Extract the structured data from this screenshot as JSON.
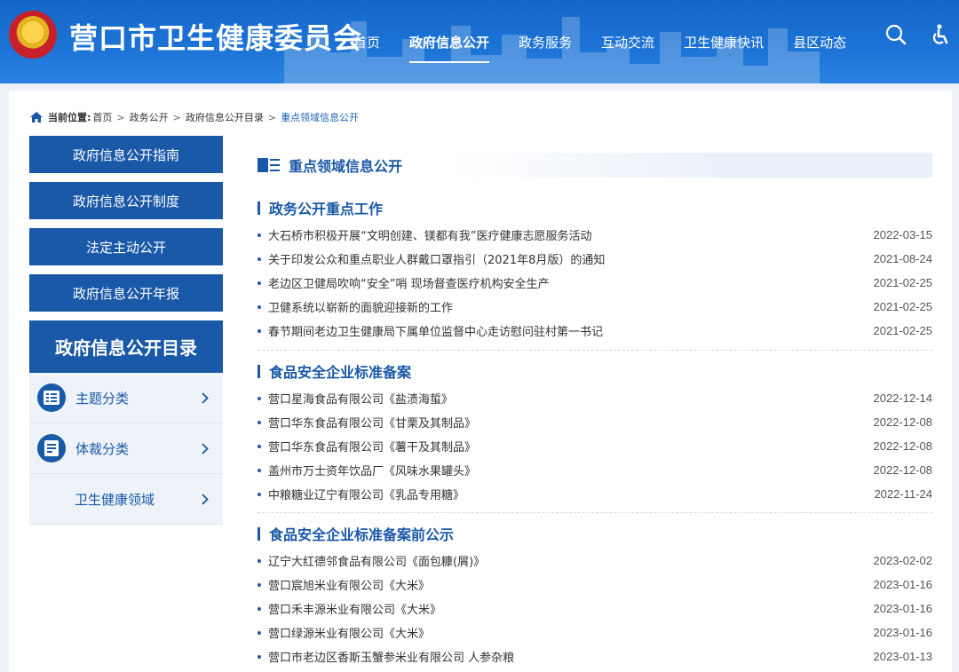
{
  "header": {
    "site_title": "营口市卫生健康委员会",
    "nav": [
      {
        "label": "首页",
        "active": false
      },
      {
        "label": "政府信息公开",
        "active": true
      },
      {
        "label": "政务服务",
        "active": false
      },
      {
        "label": "互动交流",
        "active": false
      },
      {
        "label": "卫生健康快讯",
        "active": false
      },
      {
        "label": "县区动态",
        "active": false
      }
    ],
    "icons": [
      "search-icon",
      "accessibility-icon"
    ]
  },
  "breadcrumb": {
    "prefix": "当前位置:",
    "items": [
      "首页",
      "政务公开",
      "政府信息公开目录"
    ],
    "current": "重点领域信息公开",
    "separator": ">"
  },
  "sidebar": {
    "buttons": [
      "政府信息公开指南",
      "政府信息公开制度",
      "法定主动公开",
      "政府信息公开年报"
    ],
    "catalog_title": "政府信息公开目录",
    "catalog_items": [
      {
        "label": "主题分类",
        "icon": "list-icon"
      },
      {
        "label": "体裁分类",
        "icon": "document-icon"
      },
      {
        "label": "卫生健康领域",
        "icon": ""
      }
    ]
  },
  "content": {
    "title": "重点领域信息公开",
    "sections": [
      {
        "title": "政务公开重点工作",
        "items": [
          {
            "text": "大石桥市积极开展“文明创建、镁都有我”医疗健康志愿服务活动",
            "date": "2022-03-15"
          },
          {
            "text": "关于印发公众和重点职业人群戴口罩指引（2021年8月版）的通知",
            "date": "2021-08-24"
          },
          {
            "text": "老边区卫健局吹响“安全”哨 现场督查医疗机构安全生产",
            "date": "2021-02-25"
          },
          {
            "text": "卫健系统以崭新的面貌迎接新的工作",
            "date": "2021-02-25"
          },
          {
            "text": "春节期间老边卫生健康局下属单位监督中心走访慰问驻村第一书记",
            "date": "2021-02-25"
          }
        ]
      },
      {
        "title": "食品安全企业标准备案",
        "items": [
          {
            "text": "营口星海食品有限公司《盐渍海蜇》",
            "date": "2022-12-14"
          },
          {
            "text": "营口华东食品有限公司《甘栗及其制品》",
            "date": "2022-12-08"
          },
          {
            "text": "营口华东食品有限公司《薯干及其制品》",
            "date": "2022-12-08"
          },
          {
            "text": "盖州市万士资年饮品厂《风味水果罐头》",
            "date": "2022-12-08"
          },
          {
            "text": "中粮糖业辽宁有限公司《乳品专用糖》",
            "date": "2022-11-24"
          }
        ]
      },
      {
        "title": "食品安全企业标准备案前公示",
        "items": [
          {
            "text": "辽宁大红德邻食品有限公司《面包糠(屑)》",
            "date": "2023-02-02"
          },
          {
            "text": "营口宸旭米业有限公司《大米》",
            "date": "2023-01-16"
          },
          {
            "text": "营口禾丰源米业有限公司《大米》",
            "date": "2023-01-16"
          },
          {
            "text": "营口绿源米业有限公司《大米》",
            "date": "2023-01-16"
          },
          {
            "text": "营口市老边区香斯玉蟹参米业有限公司 人参杂粮",
            "date": "2023-01-13"
          }
        ]
      }
    ]
  },
  "colors": {
    "primary": "#1a58a8",
    "header": "#1d74d6",
    "background": "#eef1f5"
  }
}
